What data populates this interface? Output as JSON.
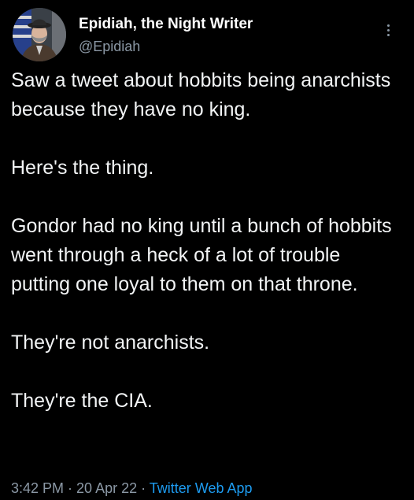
{
  "author": {
    "name": "Epidiah, the Night Writer",
    "handle": "@Epidiah"
  },
  "more_icon": "more-vertical-icon",
  "tweet": {
    "paragraphs": [
      "Saw a tweet about hobbits being anarchists because they have no king.",
      "Here's the thing.",
      "Gondor had no king until a bunch of hobbits went through a heck of a lot of trouble putting one loyal to them on that throne.",
      "They're not anarchists.",
      "They're the CIA."
    ]
  },
  "meta": {
    "time": "3:42 PM",
    "separator": " · ",
    "date": "20 Apr 22",
    "source": "Twitter Web App"
  },
  "colors": {
    "background": "#000000",
    "text": "#e7e9ea",
    "secondary": "#8b98a5",
    "link": "#1d9bf0"
  }
}
